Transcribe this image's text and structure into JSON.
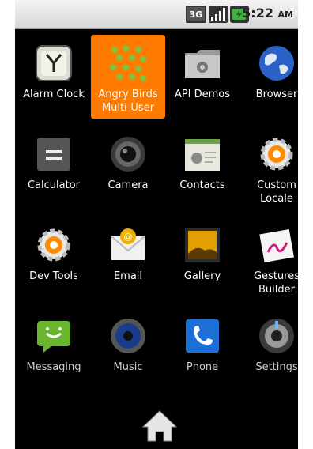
{
  "status_bar": {
    "network_label": "3G",
    "time": "5:22",
    "ampm": "AM",
    "colors": {
      "bar_top": "#f4f4f4",
      "bar_bottom": "#d6d6d6",
      "battery": "#3fb33f"
    }
  },
  "apps": [
    {
      "label": "Alarm Clock",
      "icon": "alarm-clock-icon"
    },
    {
      "label": "Angry Birds Multi-User",
      "label_line1": "Angry Birds",
      "label_line2": "Multi-User",
      "icon": "angry-birds-icon",
      "selected": true
    },
    {
      "label": "API Demos",
      "icon": "api-demos-folder-icon"
    },
    {
      "label": "Browser",
      "icon": "browser-globe-icon"
    },
    {
      "label": "Calculator",
      "icon": "calculator-icon"
    },
    {
      "label": "Camera",
      "icon": "camera-icon"
    },
    {
      "label": "Contacts",
      "icon": "contacts-icon"
    },
    {
      "label": "Custom Locale",
      "label_line1": "Custom",
      "label_line2": "Locale",
      "icon": "custom-locale-gear-icon"
    },
    {
      "label": "Dev Tools",
      "icon": "dev-tools-gear-icon"
    },
    {
      "label": "Email",
      "icon": "email-envelope-icon"
    },
    {
      "label": "Gallery",
      "icon": "gallery-picture-icon"
    },
    {
      "label": "Gestures Builder",
      "label_line1": "Gestures",
      "label_line2": "Builder",
      "icon": "gestures-builder-icon"
    },
    {
      "label": "Messaging",
      "icon": "messaging-bubble-icon"
    },
    {
      "label": "Music",
      "icon": "music-speaker-icon"
    },
    {
      "label": "Phone",
      "icon": "phone-handset-icon"
    },
    {
      "label": "Settings",
      "icon": "settings-icon"
    }
  ],
  "accent_color": "#ff7a00"
}
